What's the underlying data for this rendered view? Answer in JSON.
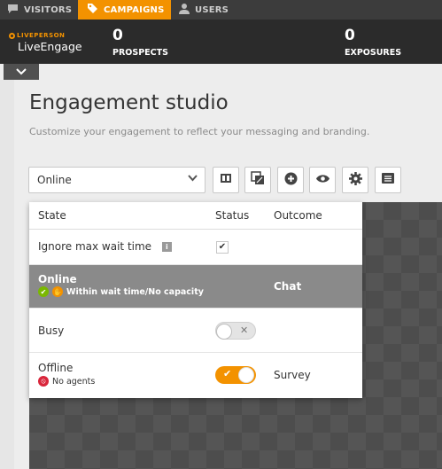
{
  "nav": {
    "tabs": [
      {
        "label": "VISITORS",
        "icon": "chat-bubble-icon"
      },
      {
        "label": "CAMPAIGNS",
        "icon": "tag-icon",
        "active": true
      },
      {
        "label": "USERS",
        "icon": "user-icon"
      }
    ]
  },
  "header": {
    "logo_top": "LIVEPERSON",
    "logo_main": "LiveEngage",
    "prospects_value": "0",
    "prospects_label": "PROSPECTS",
    "exposures_value": "0",
    "exposures_label": "EXPOSURES"
  },
  "page": {
    "title": "Engagement studio",
    "subtitle": "Customize your engagement to reflect your messaging and branding."
  },
  "toolbar": {
    "state_value": "Online",
    "buttons": [
      "film-icon",
      "layers-icon",
      "plus-circle-icon",
      "eye-icon",
      "gear-icon",
      "list-icon"
    ]
  },
  "state_panel": {
    "headers": {
      "state": "State",
      "status": "Status",
      "outcome": "Outcome"
    },
    "ignore_label": "Ignore max wait time",
    "ignore_checked": true,
    "rows": [
      {
        "state": "Online",
        "sub": "Within wait time/No capacity",
        "outcome": "Chat",
        "selected": true
      },
      {
        "state": "Busy",
        "sub": "",
        "outcome": "",
        "toggle": "off"
      },
      {
        "state": "Offline",
        "sub": "No agents",
        "outcome": "Survey",
        "toggle": "on"
      }
    ]
  },
  "colors": {
    "accent": "#f39200",
    "nav_bg": "#3c3c3c",
    "header_bg": "#2b2b2b",
    "selected_row": "#8a8a8a"
  }
}
